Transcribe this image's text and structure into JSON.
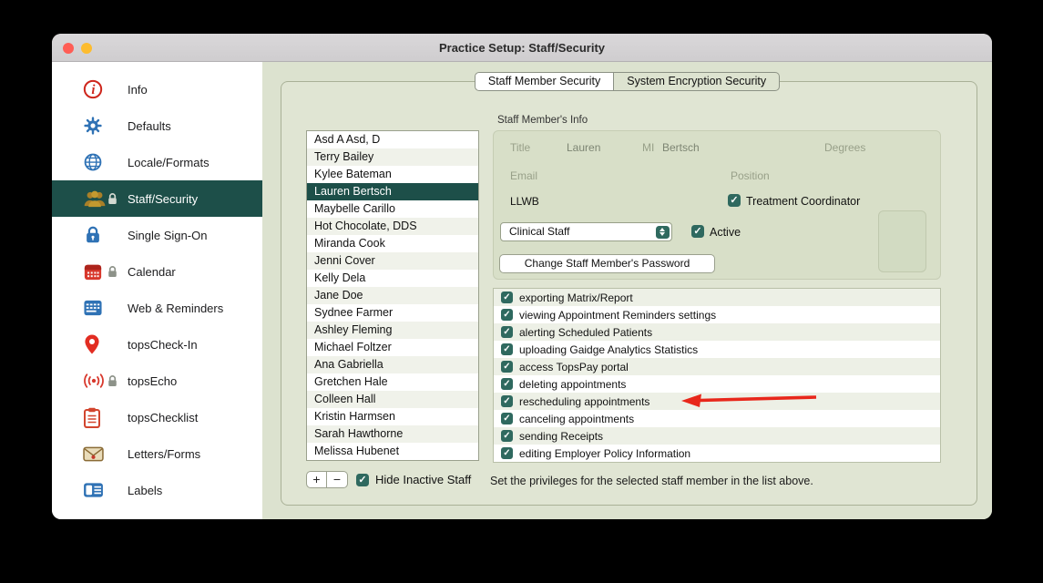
{
  "window": {
    "title": "Practice Setup: Staff/Security"
  },
  "sidebar": {
    "items": [
      {
        "label": "Info",
        "icon": "info-icon",
        "locked": false,
        "selected": false
      },
      {
        "label": "Defaults",
        "icon": "gear-icon",
        "locked": false,
        "selected": false
      },
      {
        "label": "Locale/Formats",
        "icon": "globe-icon",
        "locked": false,
        "selected": false
      },
      {
        "label": "Staff/Security",
        "icon": "people-icon",
        "locked": true,
        "selected": true
      },
      {
        "label": "Single Sign-On",
        "icon": "lock-icon",
        "locked": false,
        "selected": false
      },
      {
        "label": "Calendar",
        "icon": "calendar-icon",
        "locked": true,
        "selected": false
      },
      {
        "label": "Web & Reminders",
        "icon": "web-icon",
        "locked": false,
        "selected": false
      },
      {
        "label": "topsCheck-In",
        "icon": "pin-icon",
        "locked": false,
        "selected": false
      },
      {
        "label": "topsEcho",
        "icon": "signal-icon",
        "locked": true,
        "selected": false
      },
      {
        "label": "topsChecklist",
        "icon": "clipboard-icon",
        "locked": false,
        "selected": false
      },
      {
        "label": "Letters/Forms",
        "icon": "envelope-icon",
        "locked": false,
        "selected": false
      },
      {
        "label": "Labels",
        "icon": "label-icon",
        "locked": false,
        "selected": false
      }
    ]
  },
  "tabs": [
    {
      "label": "Staff Member Security",
      "selected": true
    },
    {
      "label": "System Encryption Security",
      "selected": false
    }
  ],
  "staff_list": {
    "items": [
      "Asd A Asd, D",
      "Terry Bailey",
      "Kylee Bateman",
      "Lauren Bertsch",
      "Maybelle Carillo",
      "Hot Chocolate, DDS",
      "Miranda Cook",
      "Jenni Cover",
      "Kelly Dela",
      "Jane Doe",
      "Sydnee Farmer",
      "Ashley Fleming",
      "Michael Foltzer",
      "Ana Gabriella",
      "Gretchen Hale",
      "Colleen Hall",
      "Kristin Harmsen",
      "Sarah Hawthorne",
      "Melissa Hubenet"
    ],
    "selected": "Lauren Bertsch",
    "add_label": "+",
    "remove_label": "−",
    "hide_inactive_label": "Hide Inactive Staff",
    "hide_inactive_checked": true
  },
  "info_panel": {
    "heading": "Staff Member's Info",
    "title_placeholder": "Title",
    "first_name": "Lauren",
    "mi_placeholder": "MI",
    "last_name": "Bertsch",
    "degrees_placeholder": "Degrees",
    "email_placeholder": "Email",
    "position_placeholder": "Position",
    "initials": "LLWB",
    "treatment_coordinator_label": "Treatment Coordinator",
    "treatment_coordinator_checked": true,
    "staff_type": "Clinical Staff",
    "active_label": "Active",
    "active_checked": true,
    "change_password_label": "Change Staff Member's Password"
  },
  "privileges": {
    "items": [
      {
        "label": "exporting Matrix/Report",
        "checked": true
      },
      {
        "label": "viewing Appointment Reminders settings",
        "checked": true
      },
      {
        "label": "alerting Scheduled Patients",
        "checked": true
      },
      {
        "label": "uploading Gaidge Analytics Statistics",
        "checked": true
      },
      {
        "label": "access TopsPay portal",
        "checked": true
      },
      {
        "label": "deleting appointments",
        "checked": true
      },
      {
        "label": "rescheduling appointments",
        "checked": true,
        "annotated": true
      },
      {
        "label": "canceling appointments",
        "checked": true
      },
      {
        "label": "sending Receipts",
        "checked": true
      },
      {
        "label": "editing Employer Policy Information",
        "checked": true
      }
    ],
    "footer": "Set the privileges for the selected staff member in the list above."
  },
  "colors": {
    "accent": "#2f695f",
    "selection": "#1d4f49",
    "arrow": "#e8271b",
    "panel_bg": "#e0e5d3"
  }
}
